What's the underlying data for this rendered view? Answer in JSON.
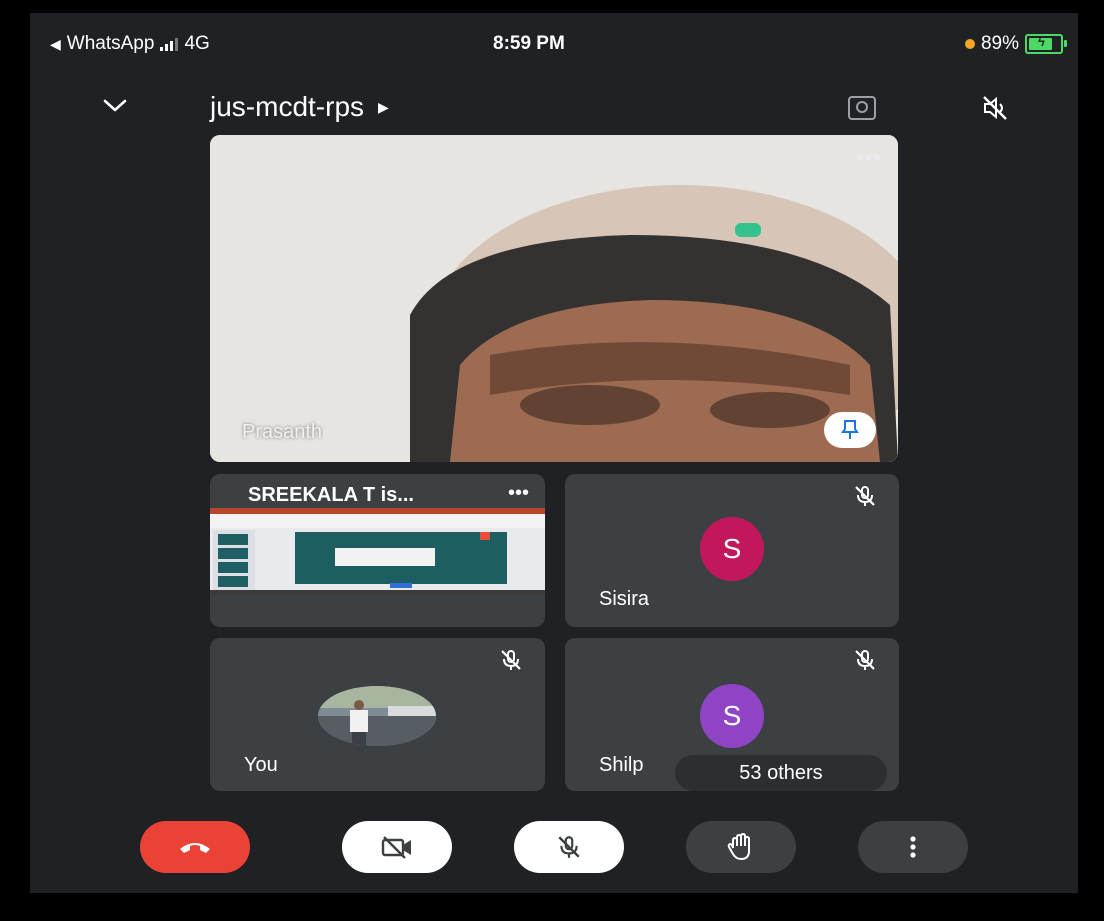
{
  "status_bar": {
    "back_app": "WhatsApp",
    "network": "4G",
    "time": "8:59 PM",
    "battery": "89%",
    "battery_level": 0.89
  },
  "header": {
    "meeting_code": "jus-mcdt-rps",
    "collapse_icon": "chevron-down-icon",
    "switch_camera_icon": "switch-camera-icon",
    "speaker_icon": "speaker-off-icon"
  },
  "participants": {
    "main": {
      "name": "Prasanth"
    },
    "presentation": {
      "title": "SREEKALA T is..."
    },
    "tile_sisira": {
      "name": "Sisira",
      "initial": "S",
      "color": "#c2185b"
    },
    "tile_you": {
      "name": "You"
    },
    "tile_shilpa": {
      "name": "Shilp",
      "initial": "S",
      "color": "#8e44c4"
    },
    "others": "53 others"
  },
  "controls": {
    "end_call_color": "#ea4335",
    "icons": [
      "end-call-icon",
      "camera-off-icon",
      "mic-off-icon",
      "raise-hand-icon",
      "more-vertical-icon"
    ]
  }
}
